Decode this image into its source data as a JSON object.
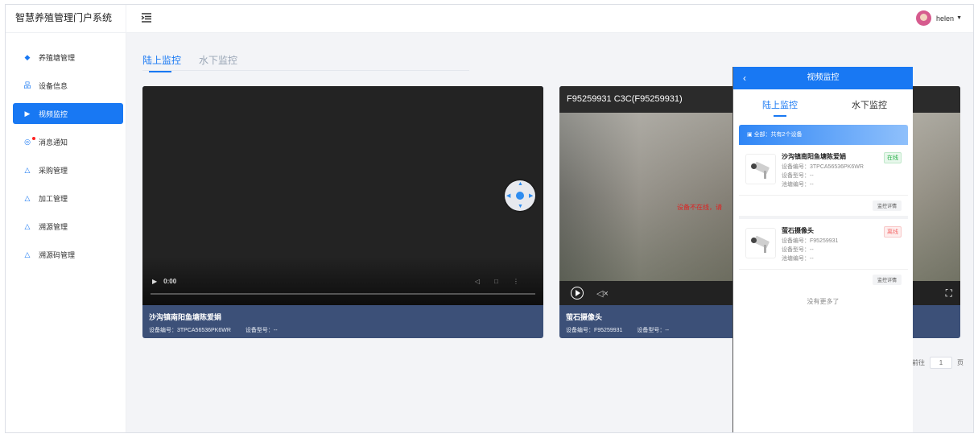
{
  "app": {
    "title": "智慧养殖管理门户系统"
  },
  "sidebar": {
    "items": [
      {
        "label": "养殖塘管理",
        "icon": "pond-icon"
      },
      {
        "label": "设备信息",
        "icon": "device-icon"
      },
      {
        "label": "视频监控",
        "icon": "camera-icon",
        "active": true
      },
      {
        "label": "消息通知",
        "icon": "bell-icon",
        "badge": true
      },
      {
        "label": "采购管理",
        "icon": "cart-icon"
      },
      {
        "label": "加工管理",
        "icon": "factory-icon"
      },
      {
        "label": "溯源管理",
        "icon": "trace-icon"
      },
      {
        "label": "溯源码管理",
        "icon": "qrcode-icon"
      }
    ]
  },
  "header": {
    "collapse_icon": "menu-fold-icon",
    "username": "helen",
    "dropdown_icon": "caret-down-icon"
  },
  "tabs": [
    {
      "label": "陆上监控",
      "active": true
    },
    {
      "label": "水下监控"
    }
  ],
  "cards": [
    {
      "time": "0:00",
      "name": "沙沟镇南阳鱼塘陈爱娟",
      "device_no_label": "设备编号：3TPCA56536PK6WR",
      "device_model_label": "设备型号：--"
    },
    {
      "stream_title": "F95259931  C3C(F95259931)",
      "offline_text": "设备不在线，请",
      "name": "萤石摄像头",
      "device_no_label": "设备编号：F95259931",
      "device_model_label": "设备型号：--"
    }
  ],
  "pager": {
    "goto": "前往",
    "page": "1",
    "suffix": "页"
  },
  "phone": {
    "title": "视频监控",
    "tabs": [
      {
        "label": "陆上监控",
        "active": true
      },
      {
        "label": "水下监控"
      }
    ],
    "group_label": "全部：共有2个设备",
    "devices": [
      {
        "name": "沙沟镇南阳鱼塘陈爱娟",
        "status": "在线",
        "line1": "设备编号：3TPCA56536PK6WR",
        "line2": "设备型号：--",
        "line3": "池塘编号：--",
        "button": "监控详情"
      },
      {
        "name": "萤石摄像头",
        "status": "离线",
        "line1": "设备编号：F95259931",
        "line2": "设备型号：--",
        "line3": "池塘编号：--",
        "button": "监控详情"
      }
    ],
    "no_more": "没有更多了"
  }
}
